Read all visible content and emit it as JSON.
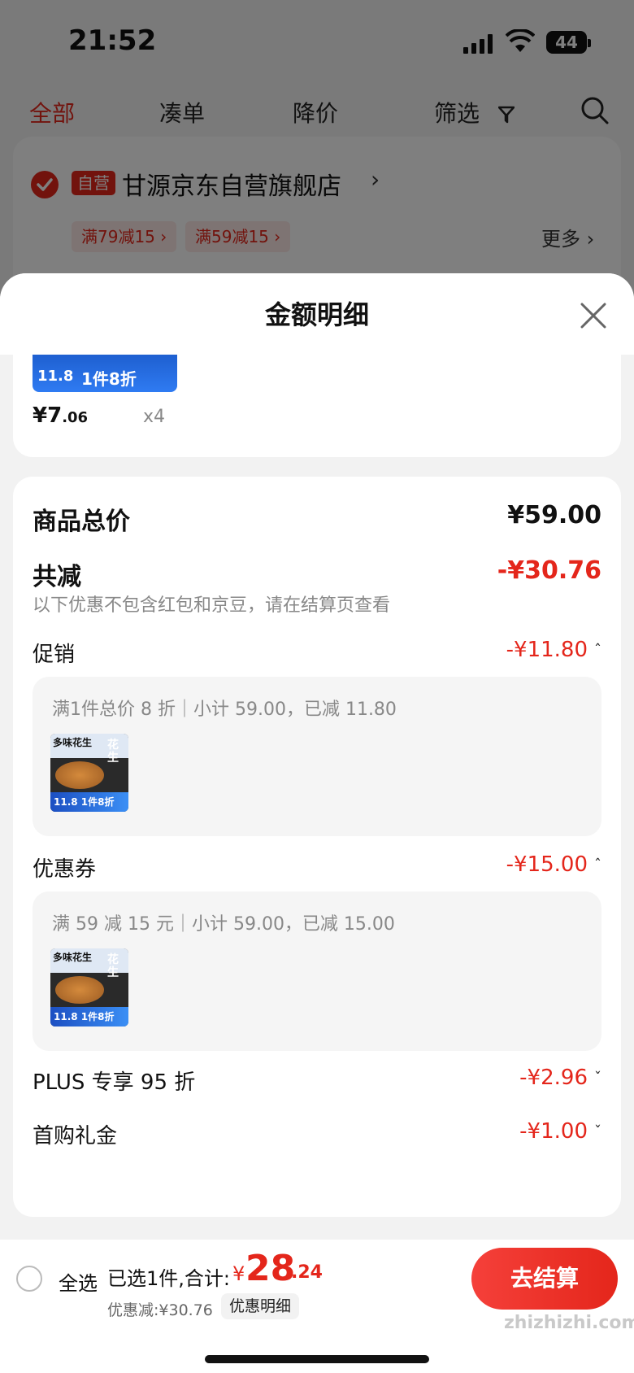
{
  "status_bar": {
    "time": "21:52",
    "battery": "44"
  },
  "nav": {
    "tabs": [
      "全部",
      "凑单",
      "降价",
      "筛选"
    ],
    "active_tab": "全部"
  },
  "store": {
    "badge": "自营",
    "name": "甘源京东自营旗舰店",
    "chevron": "›",
    "promos": [
      "满79减15 ›",
      "满59减15 ›"
    ],
    "more": "更多 ›"
  },
  "sheet": {
    "title": "金额明细",
    "goods": {
      "price_main": "¥7",
      "price_cents": ".06",
      "qty": "x4",
      "thumb_price": "11.8",
      "thumb_tag": "1件8折"
    },
    "total_label": "商品总价",
    "total_value": "¥59.00",
    "reduce_label": "共减",
    "reduce_value": "-¥30.76",
    "note": "以下优惠不包含红包和京豆，请在结算页查看",
    "promotion": {
      "label": "促销",
      "value": "-¥11.80",
      "desc": "满1件总价 8 折｜小计 59.00，已减 11.80"
    },
    "coupon": {
      "label": "优惠券",
      "value": "-¥15.00",
      "desc": "满 59 减 15 元｜小计 59.00，已减 15.00"
    },
    "thumb": {
      "title": "多味花生",
      "vert": "花生",
      "price": "11.8",
      "tag": "1件8折"
    },
    "plus": {
      "label": "PLUS 专享 95 折",
      "value": "-¥2.96"
    },
    "first_buy": {
      "label": "首购礼金",
      "value": "-¥1.00"
    },
    "chev_up": "ˆ",
    "chev_down": "ˇ"
  },
  "bottom_bar": {
    "select_all": "全选",
    "selected": "已选1件,合计:",
    "yen": "¥",
    "total_main": "28",
    "total_cents": ".24",
    "discount": "优惠减:¥30.76",
    "detail_chip": "优惠明细",
    "checkout": "去结算",
    "watermark": "zhizhizhi.com"
  },
  "colors": {
    "accent": "#e4261b",
    "overlay": "rgba(0,0,0,0.5)"
  }
}
